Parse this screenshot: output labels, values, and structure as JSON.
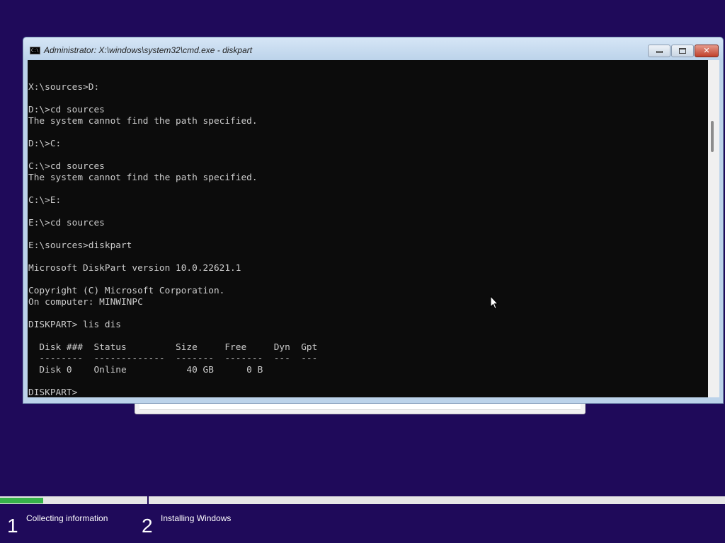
{
  "console": {
    "title": "Administrator: X:\\windows\\system32\\cmd.exe - diskpart",
    "icon": "cmd-icon",
    "icon_text": "C:\\",
    "lines": [
      "X:\\sources>D:",
      "",
      "D:\\>cd sources",
      "The system cannot find the path specified.",
      "",
      "D:\\>C:",
      "",
      "C:\\>cd sources",
      "The system cannot find the path specified.",
      "",
      "C:\\>E:",
      "",
      "E:\\>cd sources",
      "",
      "E:\\sources>diskpart",
      "",
      "Microsoft DiskPart version 10.0.22621.1",
      "",
      "Copyright (C) Microsoft Corporation.",
      "On computer: MINWINPC",
      "",
      "DISKPART> lis dis",
      "",
      "  Disk ###  Status         Size     Free     Dyn  Gpt",
      "  --------  -------------  -------  -------  ---  ---",
      "  Disk 0    Online           40 GB      0 B",
      "",
      "DISKPART> "
    ],
    "buttons": {
      "minimize_icon": "minimize-icon",
      "maximize_icon": "maximize-icon",
      "close_label": "✕"
    }
  },
  "setup": {
    "progress": 0.06,
    "steps": [
      {
        "number": "1",
        "label": "Collecting information"
      },
      {
        "number": "2",
        "label": "Installing Windows"
      }
    ]
  },
  "colors": {
    "background": "#1f0a5a",
    "progress": "#37b34a",
    "console_bg": "#0c0c0c",
    "console_text": "#cccccc"
  }
}
